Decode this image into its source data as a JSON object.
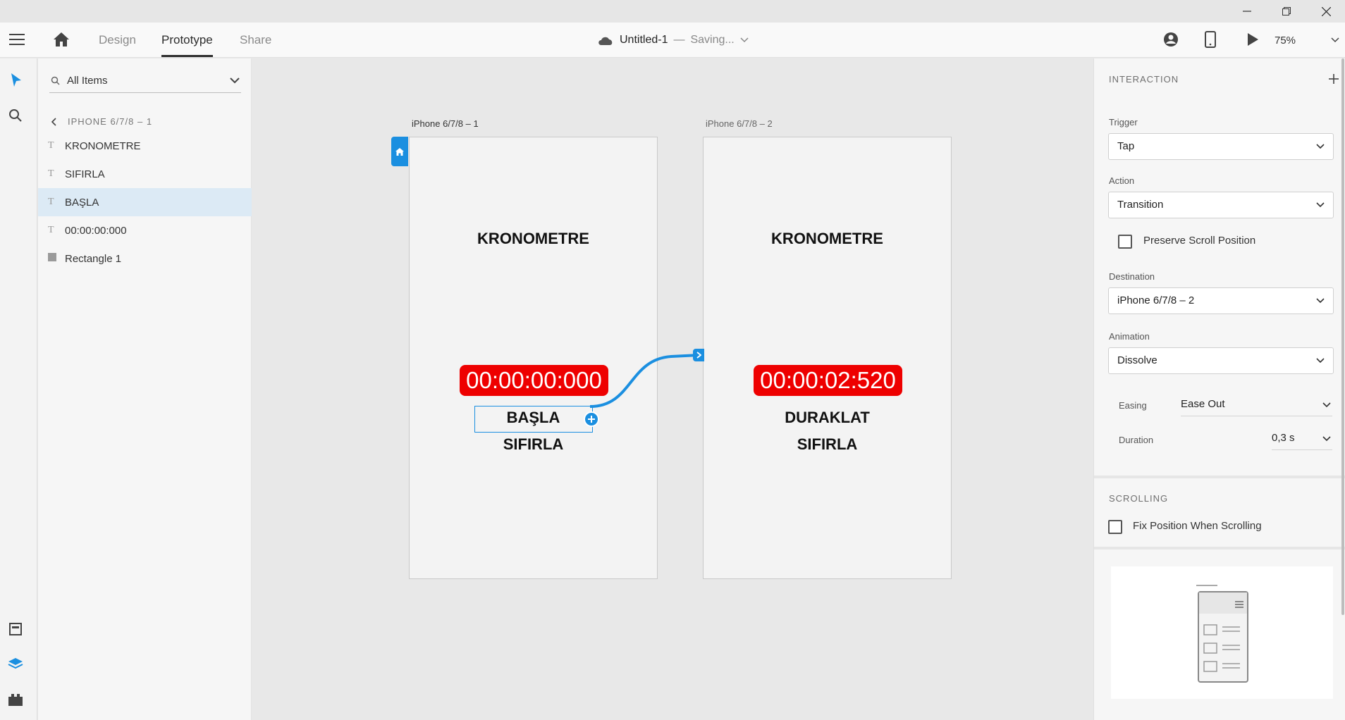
{
  "window": {
    "minimize_icon": "minimize-icon",
    "restore_icon": "restore-icon",
    "close_icon": "close-icon"
  },
  "toolbar": {
    "tabs": [
      "Design",
      "Prototype",
      "Share"
    ],
    "active_tab": "Prototype",
    "doc_title": "Untitled-1",
    "separator": "—",
    "status": "Saving...",
    "zoom": "75%"
  },
  "layers": {
    "search_placeholder": "All Items",
    "breadcrumb": "IPHONE 6/7/8 – 1",
    "items": [
      {
        "label": "KRONOMETRE",
        "icon": "text-icon"
      },
      {
        "label": "SIFIRLA",
        "icon": "text-icon"
      },
      {
        "label": "BAŞLA",
        "icon": "text-icon",
        "selected": true
      },
      {
        "label": "00:00:00:000",
        "icon": "text-icon"
      },
      {
        "label": "Rectangle 1",
        "icon": "rectangle-icon"
      }
    ]
  },
  "canvas": {
    "artboard1": {
      "label": "iPhone 6/7/8 – 1",
      "title": "KRONOMETRE",
      "timer": "00:00:00:000",
      "primary_button": "BAŞLA",
      "secondary_button": "SIFIRLA"
    },
    "artboard2": {
      "label": "iPhone 6/7/8 – 2",
      "title": "KRONOMETRE",
      "timer": "00:00:02:520",
      "primary_button": "DURAKLAT",
      "secondary_button": "SIFIRLA"
    },
    "colors": {
      "timer_bg": "#ee0000",
      "wire": "#1b8fe0"
    }
  },
  "interaction": {
    "section_title": "INTERACTION",
    "trigger_label": "Trigger",
    "trigger_value": "Tap",
    "action_label": "Action",
    "action_value": "Transition",
    "preserve_scroll_label": "Preserve Scroll Position",
    "destination_label": "Destination",
    "destination_value": "iPhone 6/7/8 – 2",
    "animation_label": "Animation",
    "animation_value": "Dissolve",
    "easing_label": "Easing",
    "easing_value": "Ease Out",
    "duration_label": "Duration",
    "duration_value": "0,3 s"
  },
  "scrolling": {
    "section_title": "SCROLLING",
    "fix_position_label": "Fix Position When Scrolling"
  }
}
